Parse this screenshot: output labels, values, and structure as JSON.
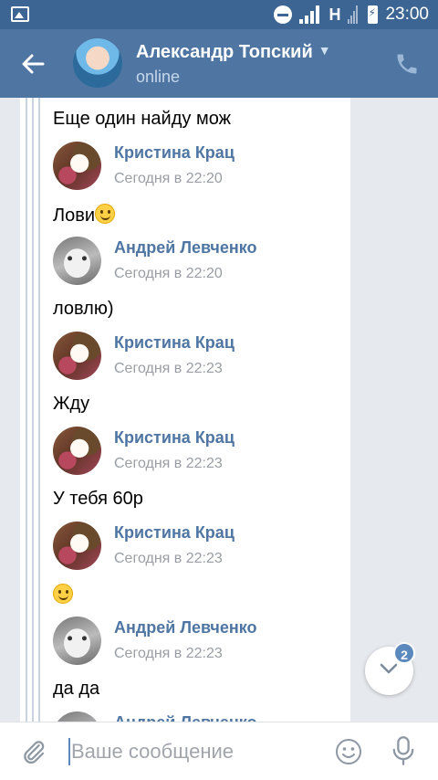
{
  "status_bar": {
    "network": "H",
    "time": "23:00"
  },
  "header": {
    "contact_name": "Александр Топский",
    "status": "online"
  },
  "messages": [
    {
      "type": "text",
      "text": "Еще один найду мож"
    },
    {
      "type": "head",
      "sender": "Кристина Крац",
      "time": "Сегодня в 22:20",
      "avatar": "kristina"
    },
    {
      "type": "text",
      "text": "Лови",
      "emoji": true
    },
    {
      "type": "head",
      "sender": "Андрей Левченко",
      "time": "Сегодня в 22:20",
      "avatar": "andrey"
    },
    {
      "type": "text",
      "text": "ловлю)"
    },
    {
      "type": "head",
      "sender": "Кристина Крац",
      "time": "Сегодня в 22:23",
      "avatar": "kristina"
    },
    {
      "type": "text",
      "text": "Жду"
    },
    {
      "type": "head",
      "sender": "Кристина Крац",
      "time": "Сегодня в 22:23",
      "avatar": "kristina"
    },
    {
      "type": "text",
      "text": "У тебя 60р"
    },
    {
      "type": "head",
      "sender": "Кристина Крац",
      "time": "Сегодня в 22:23",
      "avatar": "kristina"
    },
    {
      "type": "text",
      "text": "",
      "emoji": true
    },
    {
      "type": "head",
      "sender": "Андрей Левченко",
      "time": "Сегодня в 22:23",
      "avatar": "andrey"
    },
    {
      "type": "text",
      "text": "да да"
    },
    {
      "type": "head",
      "sender": "Андрей Левченко",
      "time": "",
      "avatar": "andrey"
    }
  ],
  "scroll_down": {
    "badge": "2"
  },
  "composer": {
    "placeholder": "Ваше сообщение"
  },
  "colors": {
    "header": "#4f76a3",
    "status_bar": "#3c6594",
    "accent": "#5b88bd",
    "sender": "#4f76a3"
  }
}
